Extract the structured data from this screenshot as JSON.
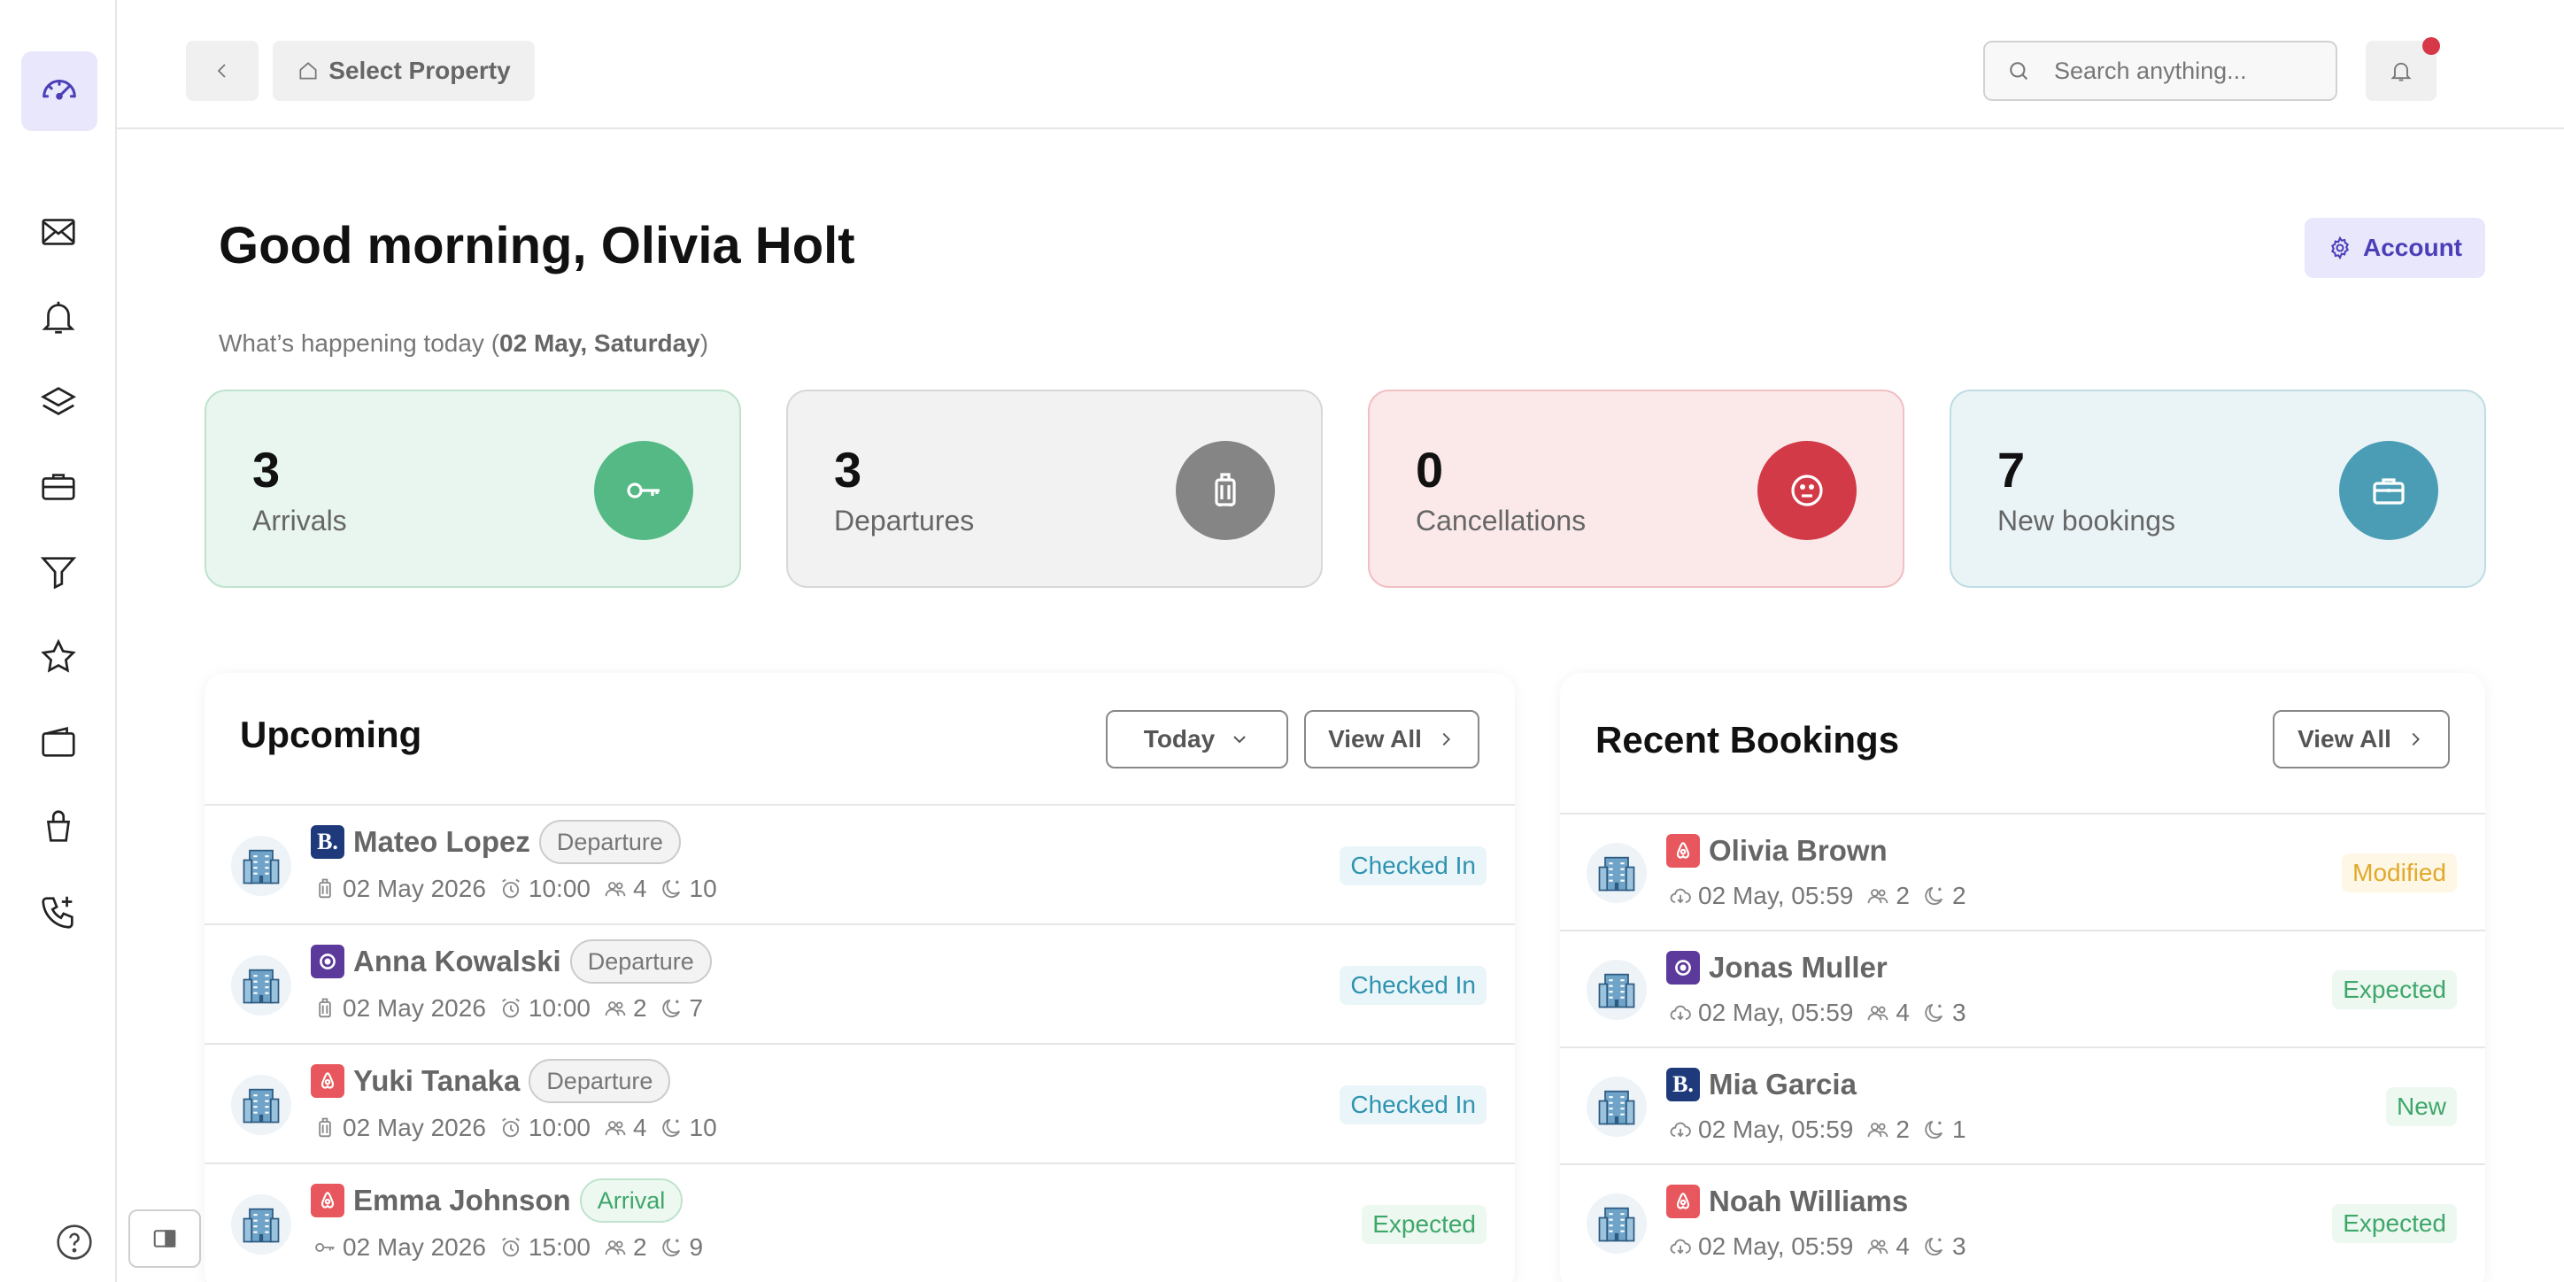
{
  "topbar": {
    "select_property": "Select Property",
    "search_placeholder": "Search anything..."
  },
  "greeting": {
    "prefix": "Good morning, ",
    "name": "Olivia Holt",
    "sub_prefix": "What’s happening today (",
    "date": "02 May, Saturday",
    "sub_suffix": ")",
    "account_label": "Account"
  },
  "stats": [
    {
      "value": "3",
      "label": "Arrivals",
      "icon": "key-icon",
      "bg": "#e9f6ef",
      "border": "#bfe3cd",
      "circle": "#54b985"
    },
    {
      "value": "3",
      "label": "Departures",
      "icon": "luggage-icon",
      "bg": "#f2f2f2",
      "border": "#d8d8d8",
      "circle": "#858585"
    },
    {
      "value": "0",
      "label": "Cancellations",
      "icon": "neutral-face-icon",
      "bg": "#fbe9ea",
      "border": "#f1bfc4",
      "circle": "#d23a47"
    },
    {
      "value": "7",
      "label": "New bookings",
      "icon": "briefcase-icon",
      "bg": "#eaf4f6",
      "border": "#bfdde4",
      "circle": "#4a9db5"
    }
  ],
  "upcoming": {
    "title": "Upcoming",
    "filter": "Today",
    "view_all": "View All",
    "rows": [
      {
        "source": "booking",
        "name": "Mateo Lopez",
        "type": "Departure",
        "date": "02 May 2026",
        "time": "10:00",
        "guests": "4",
        "nights": "10",
        "status": "Checked In",
        "meta_icon": "luggage-icon"
      },
      {
        "source": "other",
        "name": "Anna Kowalski",
        "type": "Departure",
        "date": "02 May 2026",
        "time": "10:00",
        "guests": "2",
        "nights": "7",
        "status": "Checked In",
        "meta_icon": "luggage-icon"
      },
      {
        "source": "airbnb",
        "name": "Yuki Tanaka",
        "type": "Departure",
        "date": "02 May 2026",
        "time": "10:00",
        "guests": "4",
        "nights": "10",
        "status": "Checked In",
        "meta_icon": "luggage-icon"
      },
      {
        "source": "airbnb",
        "name": "Emma Johnson",
        "type": "Arrival",
        "date": "02 May 2026",
        "time": "15:00",
        "guests": "2",
        "nights": "9",
        "status": "Expected",
        "meta_icon": "key-icon"
      }
    ]
  },
  "recent": {
    "title": "Recent Bookings",
    "view_all": "View All",
    "rows": [
      {
        "source": "airbnb",
        "name": "Olivia Brown",
        "date": "02 May, 05:59",
        "guests": "2",
        "nights": "2",
        "status": "Modified"
      },
      {
        "source": "other",
        "name": "Jonas Muller",
        "date": "02 May, 05:59",
        "guests": "4",
        "nights": "3",
        "status": "Expected"
      },
      {
        "source": "booking",
        "name": "Mia Garcia",
        "date": "02 May, 05:59",
        "guests": "2",
        "nights": "1",
        "status": "New"
      },
      {
        "source": "airbnb",
        "name": "Noah Williams",
        "date": "02 May, 05:59",
        "guests": "4",
        "nights": "3",
        "status": "Expected"
      }
    ]
  },
  "colors": {
    "accent": "#4b3fb8",
    "booking": "#1f3a7a",
    "airbnb": "#e8575d",
    "other": "#5b3a9c"
  },
  "sidebar_icons": [
    "dashboard-icon",
    "mail-icon",
    "bell-icon",
    "layers-icon",
    "briefcase-icon",
    "filter-icon",
    "star-icon",
    "wallet-icon",
    "bag-icon",
    "phone-icon"
  ]
}
